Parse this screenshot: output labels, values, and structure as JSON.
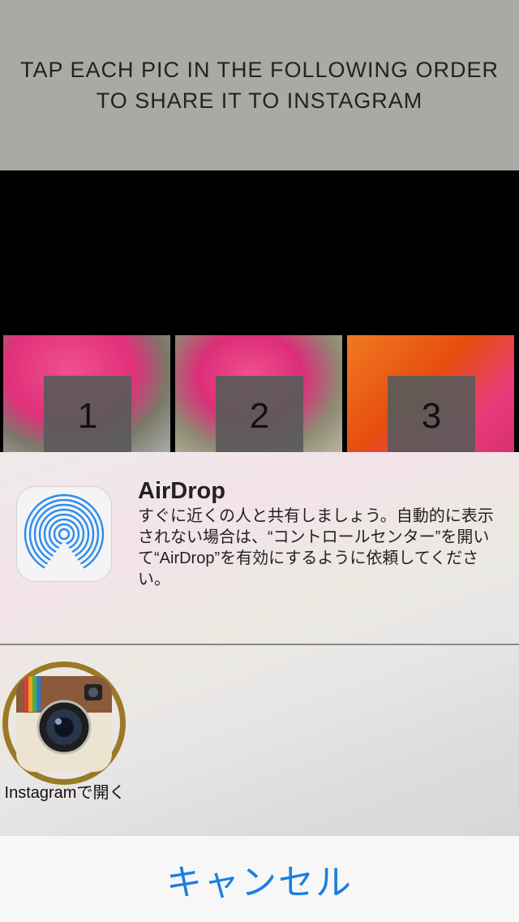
{
  "banner": {
    "line1": "TAP EACH PIC IN THE FOLLOWING ORDER",
    "line2": "TO SHARE IT TO INSTAGRAM"
  },
  "thumbnails": [
    {
      "number": "1"
    },
    {
      "number": "2"
    },
    {
      "number": "3"
    }
  ],
  "share_sheet": {
    "airdrop": {
      "title": "AirDrop",
      "description": "すぐに近くの人と共有しましょう。自動的に表示されない場合は、“コントロールセンター”を開いて“AirDrop”を有効にするように依頼してください。"
    },
    "apps": [
      {
        "label": "Instagramで開く",
        "icon": "instagram-icon"
      }
    ]
  },
  "cancel_label": "キャンセル",
  "colors": {
    "banner_bg": "#a9aaa6",
    "accent_blue": "#1a7fe0",
    "airdrop_blue": "#2a8cf0",
    "highlight_ring": "#9a7a24"
  }
}
